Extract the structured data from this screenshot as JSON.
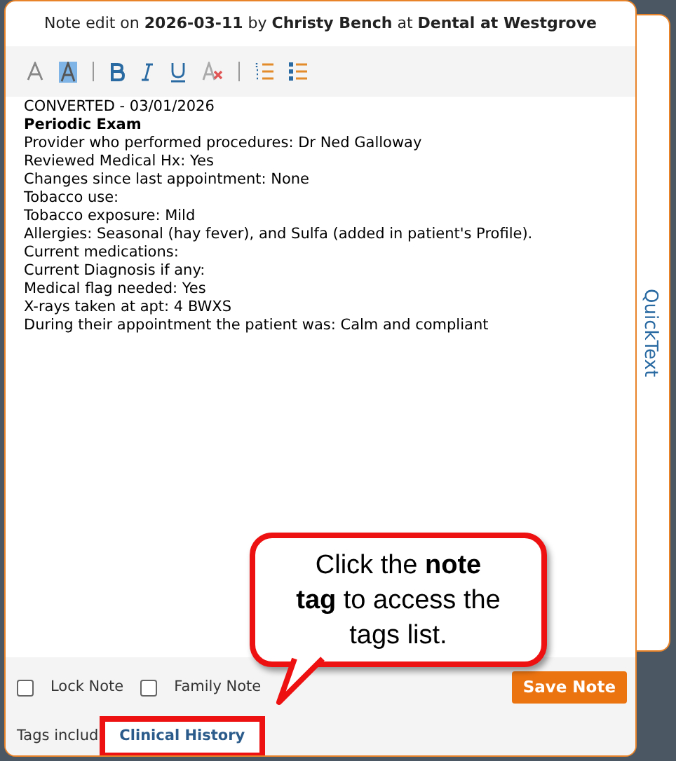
{
  "dialog": {
    "title": "Note edit on **2026-03-11** by **Christy Bench** at **Dental at Westgrove**"
  },
  "toolbar": [
    {
      "kind": "font-color"
    },
    {
      "kind": "highlight"
    },
    {
      "kind": "divider"
    },
    {
      "kind": "bold"
    },
    {
      "kind": "italic"
    },
    {
      "kind": "underline"
    },
    {
      "kind": "clear-format"
    },
    {
      "kind": "divider"
    },
    {
      "kind": "numbered-list"
    },
    {
      "kind": "bullet-list"
    }
  ],
  "note_lines": [
    {
      "kind": "plain",
      "text": "CONVERTED - 03/01/2026"
    },
    {
      "kind": "heading",
      "text": "Periodic Exam"
    },
    {
      "kind": "plain",
      "text": "Provider who performed procedures: Dr Ned Galloway"
    },
    {
      "kind": "plain",
      "text": "Reviewed Medical Hx: Yes"
    },
    {
      "kind": "plain",
      "text": "Changes since last appointment: None"
    },
    {
      "kind": "plain",
      "text": "Tobacco use:"
    },
    {
      "kind": "plain",
      "text": "Tobacco exposure: Mild"
    },
    {
      "kind": "plain",
      "text": "Allergies: Seasonal (hay fever), and Sulfa (added in patient's Profile)."
    },
    {
      "kind": "plain",
      "text": "Current medications:"
    },
    {
      "kind": "plain",
      "text": "Current Diagnosis if any:"
    },
    {
      "kind": "plain",
      "text": "Medical flag needed: Yes"
    },
    {
      "kind": "plain",
      "text": "X-rays taken at apt: 4 BWXS"
    },
    {
      "kind": "plain",
      "text": "During their appointment the patient was: Calm and compliant"
    }
  ],
  "side_panel": {
    "label": "QuickText"
  },
  "options": [
    {
      "label": "Lock Note",
      "checked": false
    },
    {
      "label": "Family Note",
      "checked": false
    }
  ],
  "save_button": "Save Note",
  "tags": {
    "label": "Tags includ",
    "tag": "Clinical History"
  },
  "callout": {
    "text": "Click the **note tag** to access the tags list."
  }
}
